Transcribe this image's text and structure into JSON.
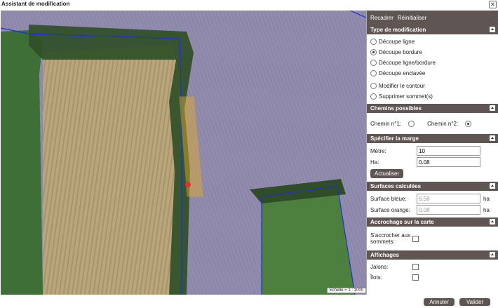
{
  "window": {
    "title": "Assistant de modification"
  },
  "map": {
    "scale_label": "Echelle = 1 : 1000"
  },
  "toolbar": {
    "recadrer": "Recadrer",
    "reinitialiser": "Réinitialiser"
  },
  "type_modification": {
    "heading": "Type de modification",
    "options": [
      "Découpe ligne",
      "Découpe bordure",
      "Découpe ligne/bordure",
      "Découpe enclavée",
      "Modifier le contour",
      "Supprimer sommet(s)"
    ],
    "selected": "Découpe bordure"
  },
  "chemins": {
    "heading": "Chemins possibles",
    "chemin1": "Chemin n°1:",
    "chemin2": "Chemin n°2:",
    "selected": "Chemin n°2:"
  },
  "marge": {
    "heading": "Spécifier la marge",
    "metre_label": "Mètre:",
    "metre_value": "10",
    "ha_label": "Ha:",
    "ha_value": "0.08",
    "actualiser": "Actualiser"
  },
  "surfaces": {
    "heading": "Surfaces calculées",
    "bleue_label": "Surface bleue:",
    "bleue_value": "6.58",
    "orange_label": "Surface orange:",
    "orange_value": "0.08",
    "unit": "ha"
  },
  "accrochage": {
    "heading": "Accrochage sur la carte",
    "label": "S'accrocher aux sommets:"
  },
  "affichages": {
    "heading": "Affichages",
    "jalons": "Jalons:",
    "ilots": "Îlots:"
  },
  "footer": {
    "annuler": "Annuler",
    "valider": "Valider"
  },
  "colors": {
    "panel_header": "#5f5654",
    "boundary": "#1f2fd6",
    "selection": "#e8b020"
  }
}
